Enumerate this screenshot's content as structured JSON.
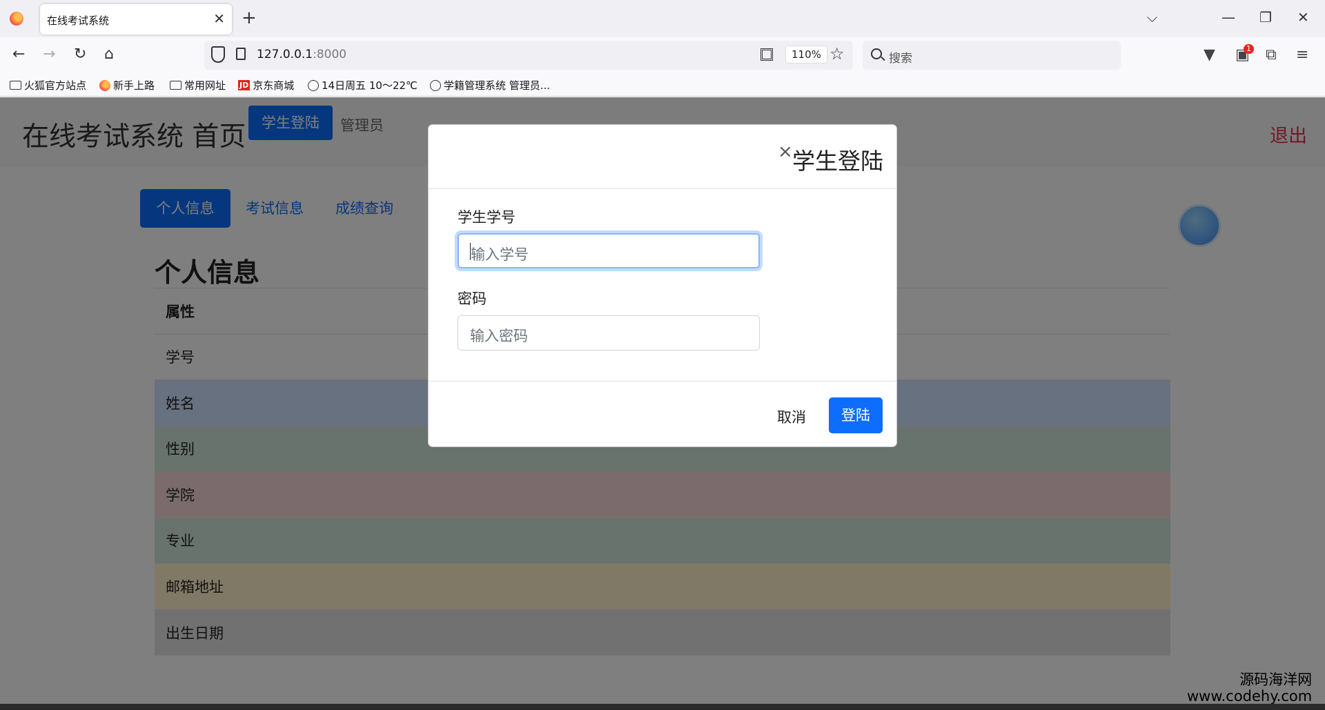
{
  "browser": {
    "tab_title": "在线考试系统",
    "tab_close": "✕",
    "new_tab": "+",
    "url_host": "127.0.0.1",
    "url_port": ":8000",
    "zoom": "110%",
    "search_placeholder": "搜索",
    "extension_badge": "1",
    "bookmarks": [
      {
        "label": "火狐官方站点",
        "icon": "folder-icon"
      },
      {
        "label": "新手上路",
        "icon": "firefox-icon"
      },
      {
        "label": "常用网址",
        "icon": "folder-icon"
      },
      {
        "label": "京东商城",
        "icon": "jd-icon"
      },
      {
        "label": "14日周五  10～22℃",
        "icon": "globe-icon"
      },
      {
        "label": "学籍管理系统 管理员...",
        "icon": "globe-icon"
      }
    ],
    "jd_logo": "JD"
  },
  "site": {
    "brand": "在线考试系统 首页",
    "student_login_btn": "学生登陆",
    "admin_link": "管理员",
    "logout": "退出"
  },
  "tabs": [
    {
      "label": "个人信息",
      "active": true
    },
    {
      "label": "考试信息",
      "active": false
    },
    {
      "label": "成绩查询",
      "active": false
    }
  ],
  "section_title": "个人信息",
  "table": {
    "header": "属性",
    "rows": [
      "学号",
      "姓名",
      "性别",
      "学院",
      "专业",
      "邮箱地址",
      "出生日期"
    ]
  },
  "modal": {
    "close": "×",
    "title": "学生登陆",
    "id_label": "学生学号",
    "id_placeholder": "输入学号",
    "password_label": "密码",
    "password_placeholder": "输入密码",
    "cancel": "取消",
    "login": "登陆"
  },
  "watermark": {
    "line1": "源码海洋网",
    "line2": "www.codehy.com"
  },
  "colors": {
    "primary": "#0d6efd",
    "danger": "#dc3545"
  }
}
